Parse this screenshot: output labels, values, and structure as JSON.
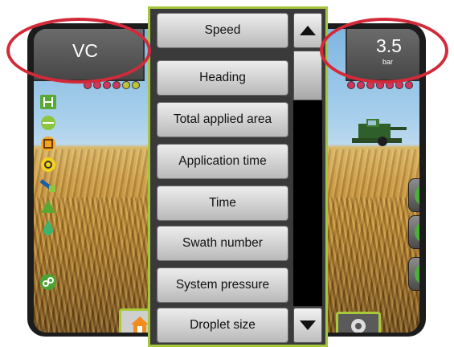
{
  "header": {
    "left": {
      "label": "VC"
    },
    "right": {
      "value": "3.5",
      "unit": "bar"
    }
  },
  "menu": {
    "items": [
      {
        "label": "Speed"
      },
      {
        "label": "Heading"
      },
      {
        "label": "Total applied area"
      },
      {
        "label": "Application time"
      },
      {
        "label": "Time"
      },
      {
        "label": "Swath number"
      },
      {
        "label": "System pressure"
      },
      {
        "label": "Droplet size"
      }
    ]
  },
  "boom_sections_left": [
    "#d3365c",
    "#d3365c",
    "#d3365c",
    "#d3365c",
    "#c0c43a",
    "#c0c43a"
  ],
  "boom_sections_right": [
    "#d3365c",
    "#d3365c",
    "#d3365c",
    "#d3365c",
    "#d3365c",
    "#d3365c",
    "#d3365c"
  ],
  "left_toolbar_icons": [
    "guidance-mode-icon",
    "straight-ab-icon",
    "boundary-icon",
    "steering-icon",
    "implement-icon",
    "marker-icon",
    "droplet-icon",
    "rate-control-icon"
  ],
  "right_buttons": [
    "north-arrow-icon",
    "screen-mode-icon",
    "target-icon"
  ],
  "colors": {
    "accent": "#a5c63b",
    "highlight": "#d32a3a",
    "active_section": "#d3365c"
  }
}
